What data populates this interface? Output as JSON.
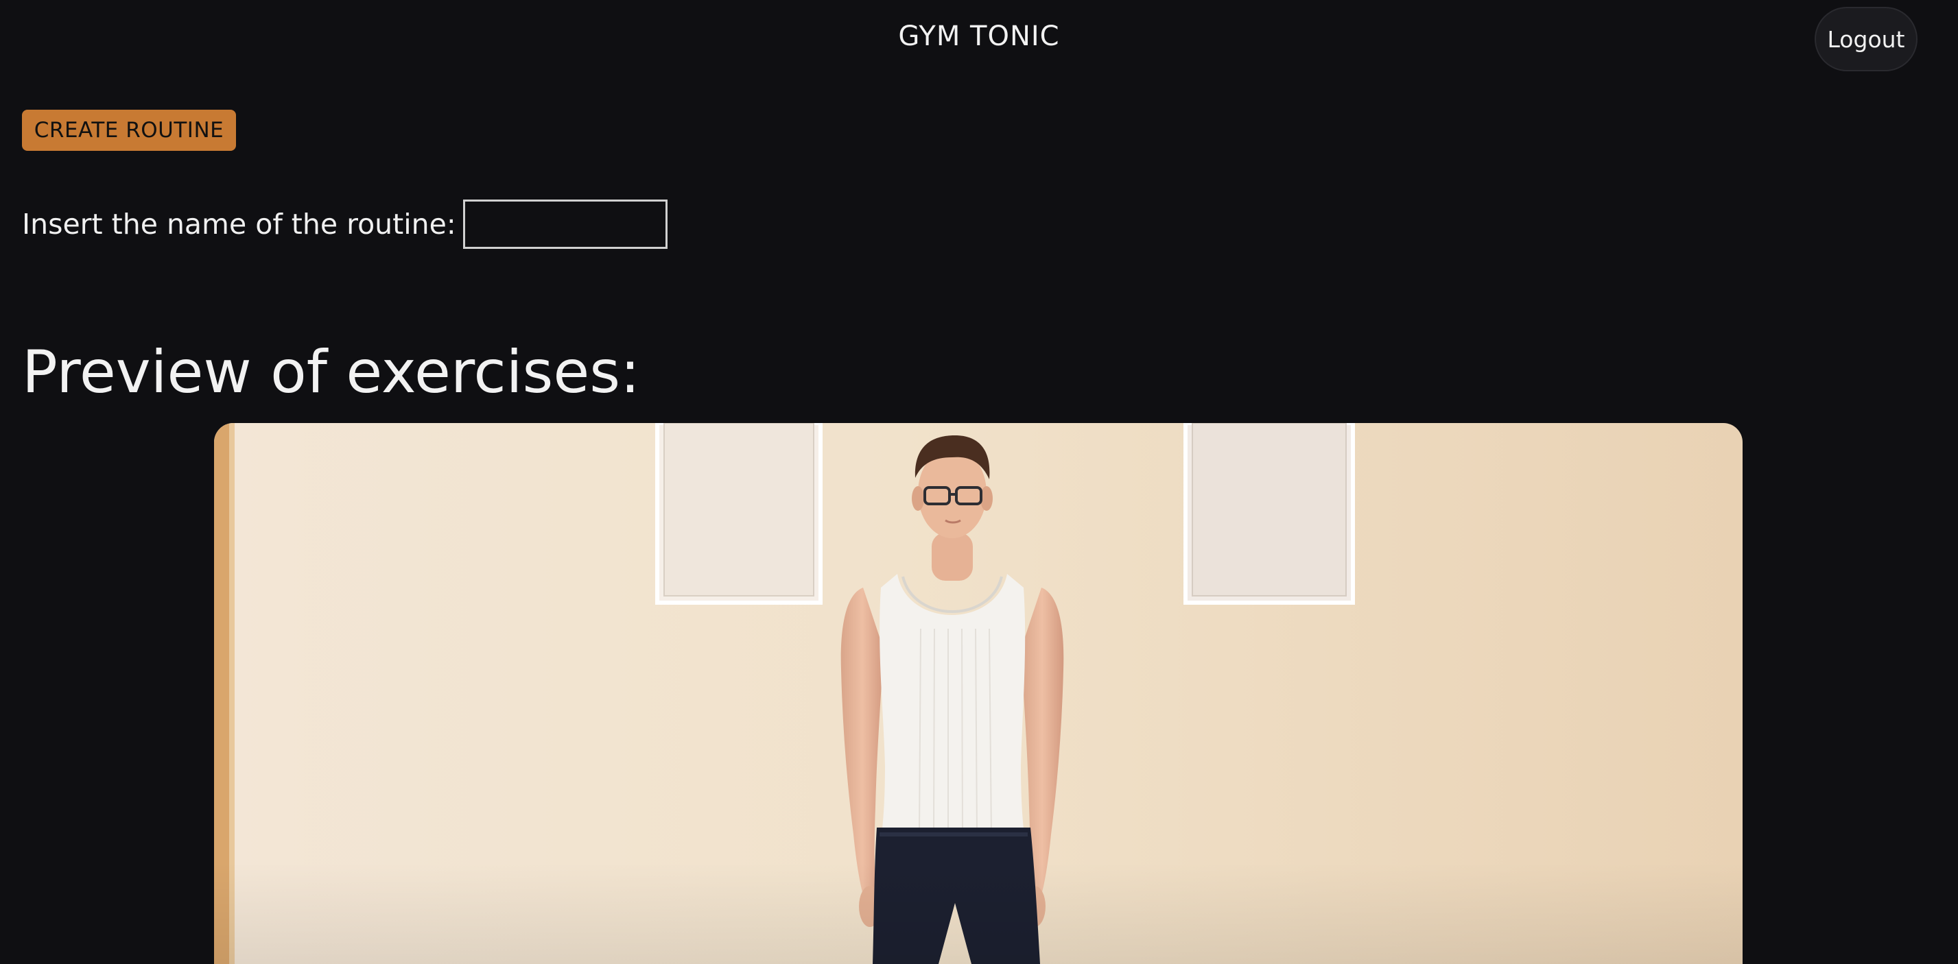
{
  "header": {
    "app_title": "GYM TONIC",
    "logout_label": "Logout"
  },
  "actions": {
    "create_routine_label": "CREATE ROUTINE"
  },
  "routine_form": {
    "name_label": "Insert the name of the routine:",
    "name_value": ""
  },
  "preview": {
    "heading": "Preview of exercises:",
    "video_icon": "exercise-video-thumbnail"
  },
  "colors": {
    "background": "#0f0f12",
    "accent": "#c87a33",
    "wall": "#f0e0c8",
    "shirt": "#f4f2ee",
    "shorts": "#1c2030"
  }
}
